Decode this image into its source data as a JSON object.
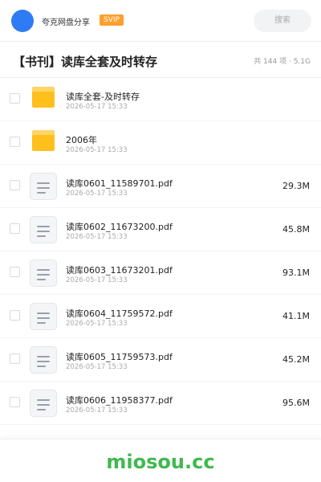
{
  "header": {
    "brand": "夸克网盘分享",
    "badge": "SVIP",
    "search_label": "搜索"
  },
  "share": {
    "title": "【书刊】读库全套及时转存",
    "count": "共 144 项",
    "size": "5.1G"
  },
  "files": [
    {
      "type": "folder",
      "name": "读库全套-及时转存",
      "date": "2026-05-17 15:33",
      "size": ""
    },
    {
      "type": "folder",
      "name": "2006年",
      "date": "2026-05-17 15:33",
      "size": ""
    },
    {
      "type": "file",
      "name": "读库0601_11589701.pdf",
      "date": "2026-05-17 15:33",
      "size": "29.3M"
    },
    {
      "type": "file",
      "name": "读库0602_11673200.pdf",
      "date": "2026-05-17 15:33",
      "size": "45.8M"
    },
    {
      "type": "file",
      "name": "读库0603_11673201.pdf",
      "date": "2026-05-17 15:33",
      "size": "93.1M"
    },
    {
      "type": "file",
      "name": "读库0604_11759572.pdf",
      "date": "2026-05-17 15:33",
      "size": "41.1M"
    },
    {
      "type": "file",
      "name": "读库0605_11759573.pdf",
      "date": "2026-05-17 15:33",
      "size": "45.2M"
    },
    {
      "type": "file",
      "name": "读库0606_11958377.pdf",
      "date": "2026-05-17 15:33",
      "size": "95.6M"
    }
  ],
  "watermark": "miosou.cc",
  "colors": {
    "accent": "#2f7bf5",
    "svip": "#ff9f2e",
    "folder": "#ffc01e",
    "watermark": "#3fb950"
  }
}
